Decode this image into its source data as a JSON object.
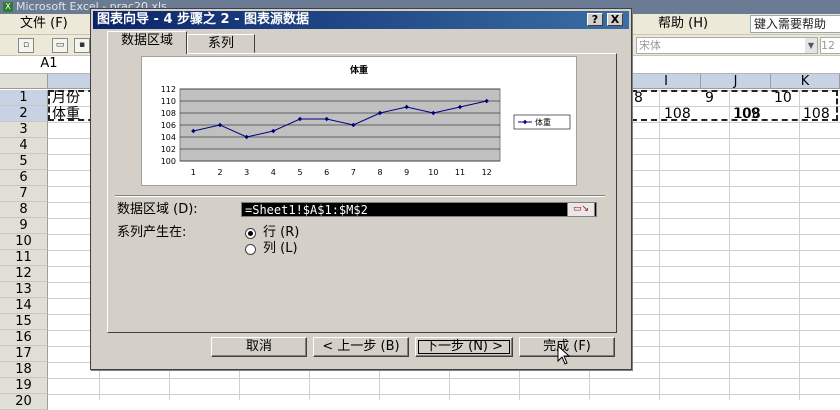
{
  "window": {
    "title": "Microsoft Excel - prac20.xls",
    "app_icon": "X"
  },
  "menu": {
    "file": "文件 (F)",
    "help": "帮助 (H)",
    "help_placeholder": "键入需要帮助"
  },
  "toolbar": {
    "font_name": "宋体",
    "font_size": "12"
  },
  "formula_bar": {
    "name_box": "A1"
  },
  "columns": [
    "I",
    "J",
    "K"
  ],
  "rows": [
    "1",
    "2",
    "3",
    "4",
    "5",
    "6",
    "7",
    "8",
    "9",
    "10",
    "11",
    "12",
    "13",
    "14",
    "15",
    "16",
    "17",
    "18",
    "19",
    "20"
  ],
  "cells": {
    "a1": "月份",
    "a2": "体重",
    "h1": "8",
    "i1": "9",
    "k1": "10",
    "h2": "108",
    "i2": "108",
    "j2": "109",
    "k2": "108"
  },
  "dialog": {
    "title": "图表向导 - 4 步骤之 2 - 图表源数据",
    "help_btn": "?",
    "close_btn": "X",
    "tabs": [
      {
        "label": "数据区域",
        "active": true
      },
      {
        "label": "系列",
        "active": false
      }
    ],
    "data_range_label": "数据区域 (D):",
    "data_range_value": "=Sheet1!$A$1:$M$2",
    "series_in_label": "系列产生在:",
    "radio_rows": "行 (R)",
    "radio_cols": "列 (L)",
    "radio_selected": "rows",
    "buttons": {
      "cancel": "取消",
      "back": "< 上一步 (B)",
      "next": "下一步 (N) >",
      "finish": "完成 (F)"
    }
  },
  "chart_data": {
    "type": "line",
    "title": "体重",
    "x": [
      1,
      2,
      3,
      4,
      5,
      6,
      7,
      8,
      9,
      10,
      11,
      12
    ],
    "series": [
      {
        "name": "体重",
        "values": [
          105,
          106,
          104,
          105,
          107,
          107,
          106,
          108,
          109,
          108,
          109,
          110
        ]
      }
    ],
    "ylim": [
      100,
      112
    ],
    "yticks": [
      100,
      102,
      104,
      106,
      108,
      110,
      112
    ],
    "grid": true,
    "legend": "right",
    "plot_background": "#c0c0c0",
    "line_color": "#000080"
  }
}
